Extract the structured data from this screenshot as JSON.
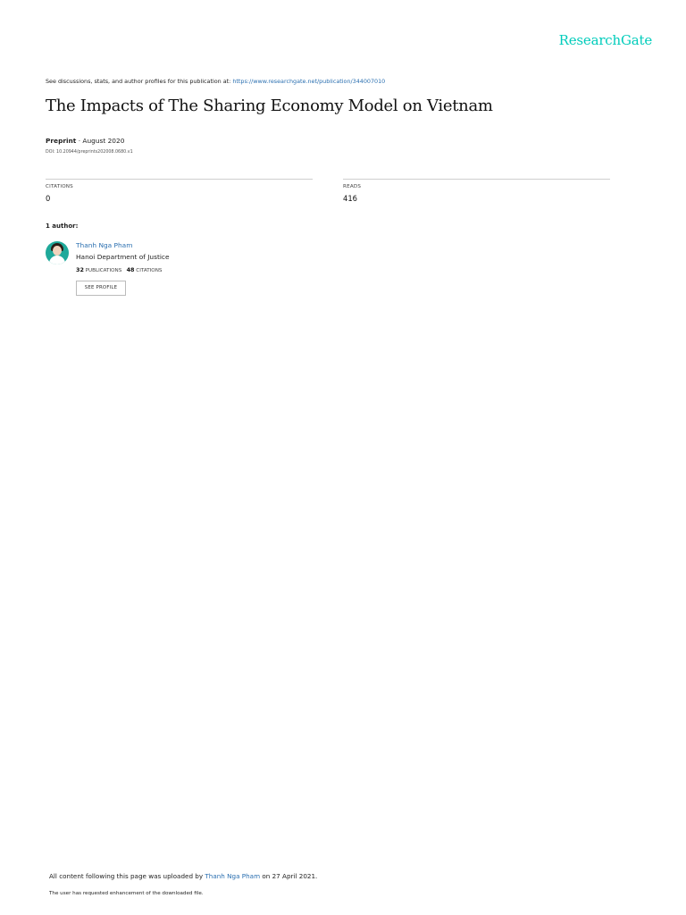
{
  "brand": {
    "logo_text": "ResearchGate",
    "accent_color": "#00ccbb",
    "link_color": "#2a6fb0"
  },
  "header": {
    "discussion_prefix": "See discussions, stats, and author profiles for this publication at: ",
    "publication_url": "https://www.researchgate.net/publication/344007010"
  },
  "publication": {
    "title": "The Impacts of The Sharing Economy Model on Vietnam",
    "type": "Preprint",
    "date_text": " · August 2020",
    "doi": "DOI: 10.20944/preprints202008.0680.v1"
  },
  "stats": {
    "citations_label": "CITATIONS",
    "citations_value": "0",
    "reads_label": "READS",
    "reads_value": "416"
  },
  "authors": {
    "count_label": "1 author:",
    "list": [
      {
        "name": "Thanh Nga Pham",
        "institution": "Hanoi Department of Justice",
        "publications_count": "32",
        "publications_label": " PUBLICATIONS",
        "citations_count": "48",
        "citations_label": " CITATIONS",
        "see_profile_label": "SEE PROFILE",
        "avatar_icon": "author-photo-avatar"
      }
    ]
  },
  "footer": {
    "uploaded_prefix": "All content following this page was uploaded by ",
    "uploader_name": "Thanh Nga Pham",
    "uploaded_suffix": " on 27 April 2021.",
    "enhancement_note": "The user has requested enhancement of the downloaded file."
  }
}
